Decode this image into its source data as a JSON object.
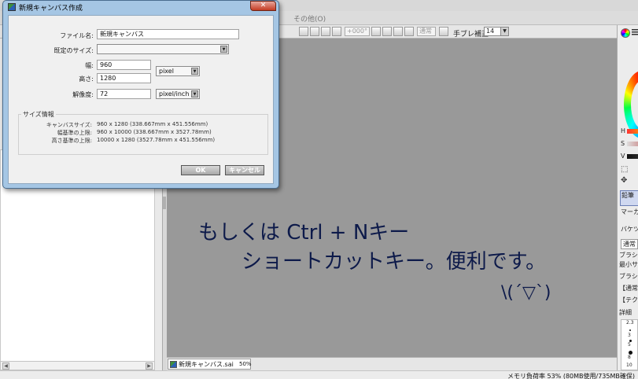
{
  "main": {
    "menubar": {
      "other_menu": "その他(O)"
    },
    "toolbar": {
      "angle_value": "+000°",
      "blend_mode": "通常",
      "stabilizer_label": "手ブレ補正",
      "stabilizer_value": "14"
    },
    "canvas": {
      "handwriting": {
        "line1": "もしくは Ctrl + Nキー",
        "line2": "ショートカットキー。便利です。",
        "line3": "\\(´▽`)"
      },
      "doc_tab": {
        "name": "新規キャンバス.sai",
        "zoom": "50%"
      }
    },
    "status_bar": {
      "text": "メモリ負荷率 53% (80MB使用/735MB確保)"
    },
    "right_panel": {
      "h_label": "H",
      "s_label": "S",
      "v_label": "V",
      "pencil_label": "鉛筆",
      "marker_label": "マーカー",
      "bucket_label": "バケツ",
      "blend_mode": "通常",
      "brush_size_label": "ブラシサ",
      "min_size_label": "最小サ",
      "brush_density_label": "ブラシ濃",
      "normal_bracket": "【通常",
      "texture_bracket": "【テクス",
      "detail_label": "詳細",
      "brush_sizes": [
        "2.3",
        "3",
        "5",
        "8",
        "10"
      ]
    }
  },
  "dialog": {
    "title": "新規キャンバス作成",
    "close_glyph": "✕",
    "filename_label": "ファイル名:",
    "filename_value": "新規キャンバス",
    "preset_label": "既定のサイズ:",
    "preset_value": "",
    "width_label": "幅:",
    "width_value": "960",
    "height_label": "高さ:",
    "height_value": "1280",
    "unit_value": "pixel",
    "resolution_label": "解像度:",
    "resolution_value": "72",
    "resolution_unit": "pixel/inch",
    "size_info": {
      "legend": "サイズ情報",
      "rows": [
        {
          "label": "キャンバスサイズ:",
          "value": "960 x 1280 (338.667mm x 451.556mm)"
        },
        {
          "label": "幅基準の上限:",
          "value": "960 x 10000 (338.667mm x 3527.78mm)"
        },
        {
          "label": "高さ基準の上限:",
          "value": "10000 x 1280 (3527.78mm x 451.556mm)"
        }
      ]
    },
    "ok_label": "OK",
    "cancel_label": "キャンセル"
  },
  "icons": {
    "app_icon": "sai-app-icon",
    "close_icon": "close-icon",
    "dropdown_icon": "chevron-down-icon",
    "color_wheel": "color-wheel-icon",
    "menu": "menu-lines-icon",
    "select_tool": "selection-rect-icon",
    "move_tool": "move-cross-icon"
  },
  "colors": {
    "dialog_frame": "#a5c6e4",
    "canvas_bg": "#999999",
    "ink": "#0d1a4a",
    "close_button": "#c43b22"
  }
}
